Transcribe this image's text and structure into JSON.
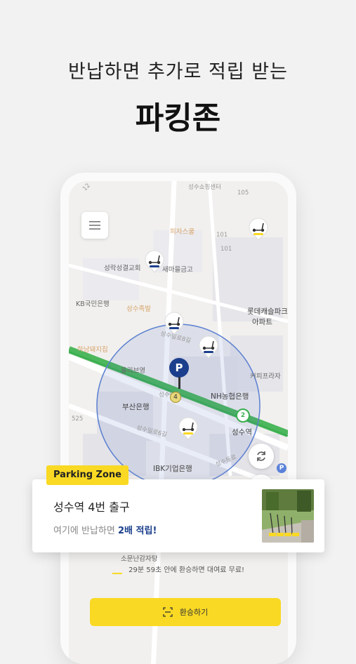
{
  "promo": {
    "headline": "반납하면 추가로 적립 받는",
    "title": "파킹존"
  },
  "map": {
    "labels": {
      "shopping": "성수쇼핑센터",
      "pizza": "피자스쿨",
      "church": "성락성결교회",
      "credit": "새마을금고",
      "kb": "KB국민은행",
      "jokbal": "성수족발",
      "lotte": "롯데캐슬파크",
      "apt": "아파트",
      "haenam": "하남돼지집",
      "olive": "올리브영",
      "busan": "부산은행",
      "nh": "NH농협은행",
      "cafe": "커피프라자",
      "seongsu": "성수역",
      "ibk": "IBK기업은행",
      "road1": "성수일로8길",
      "road2": "성수일로6길",
      "road3": "성수이로",
      "road4": "성수동로",
      "sobang": "소문난감자탕",
      "n101a": "101",
      "n101b": "101",
      "n105": "105",
      "n12": "12",
      "n525": "525",
      "line2": "2",
      "exit4": "4",
      "parking": "P"
    }
  },
  "parking_pin": {
    "label": "P"
  },
  "card": {
    "badge": "Parking Zone",
    "station": "성수역 4번 출구",
    "desc_prefix": "여기에 반납하면 ",
    "desc_highlight": "2배 적립!"
  },
  "bottom": {
    "free_notice": "29분 59초 안에 환승하면 대여료 무료!",
    "return_button": "환승하기"
  },
  "colors": {
    "accent_yellow": "#f9d923",
    "brand_blue": "#1b3f8c",
    "subway_green": "#3aae4f"
  }
}
